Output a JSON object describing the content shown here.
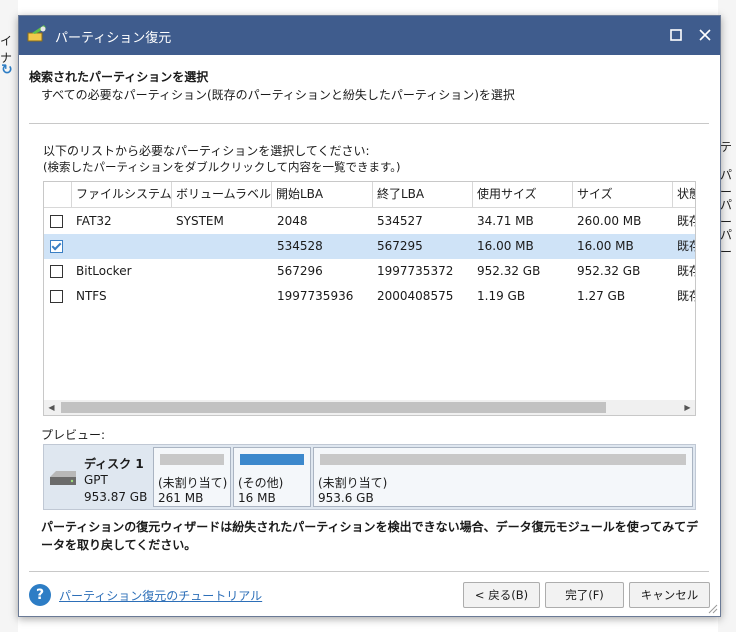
{
  "background": {
    "left_text": [
      "イナ"
    ],
    "left_icon": "refresh-icon",
    "right_items": [
      "テ",
      "パー",
      "パー",
      "パー"
    ]
  },
  "titlebar": {
    "icon": "partition-recovery-icon",
    "title": "パーティション復元",
    "maximize_icon": "maximize-icon",
    "close_icon": "close-icon"
  },
  "header": {
    "title": "検索されたパーティションを選択",
    "subtitle": "すべての必要なパーティション(既存のパーティションと紛失したパーティション)を選択"
  },
  "instructions": {
    "line1": "以下のリストから必要なパーティションを選択してください:",
    "line2": "(検索したパーティションをダブルクリックして内容を一覧できます。)"
  },
  "table": {
    "columns": [
      "",
      "ファイルシステム",
      "ボリュームラベル",
      "開始LBA",
      "終了LBA",
      "使用サイズ",
      "サイズ",
      "状態"
    ],
    "rows": [
      {
        "checked": false,
        "fs": "FAT32",
        "label": "SYSTEM",
        "start": "2048",
        "end": "534527",
        "used": "34.71 MB",
        "size": "260.00 MB",
        "status": "既存"
      },
      {
        "checked": true,
        "fs": "",
        "label": "",
        "start": "534528",
        "end": "567295",
        "used": "16.00 MB",
        "size": "16.00 MB",
        "status": "既存"
      },
      {
        "checked": false,
        "fs": "BitLocker",
        "label": "",
        "start": "567296",
        "end": "1997735372",
        "used": "952.32 GB",
        "size": "952.32 GB",
        "status": "既存"
      },
      {
        "checked": false,
        "fs": "NTFS",
        "label": "",
        "start": "1997735936",
        "end": "2000408575",
        "used": "1.19 GB",
        "size": "1.27 GB",
        "status": "既存"
      }
    ],
    "selected_row_color": "#cfe3f7"
  },
  "preview": {
    "label": "プレビュー:",
    "disk": {
      "name": "ディスク 1",
      "type": "GPT",
      "size": "953.87 GB",
      "icon": "hard-disk-icon"
    },
    "partitions": [
      {
        "label": "(未割り当て)",
        "size": "261 MB",
        "used": false
      },
      {
        "label": "(その他)",
        "size": "16 MB",
        "used": true
      },
      {
        "label": "(未割り当て)",
        "size": "953.6 GB",
        "used": false
      }
    ],
    "used_color": "#3c88cc"
  },
  "note": "パーティションの復元ウィザードは紛失されたパーティションを検出できない場合、データ復元モジュールを使ってみてデータを取り戻してください。",
  "footer": {
    "help_icon": "help-icon",
    "help_link": "パーティション復元のチュートリアル",
    "back_button": "< 戻る(B)",
    "finish_button": "完了(F)",
    "cancel_button": "キャンセル"
  },
  "colors": {
    "titlebar": "#3f5c8d",
    "link": "#2d6fb8"
  }
}
